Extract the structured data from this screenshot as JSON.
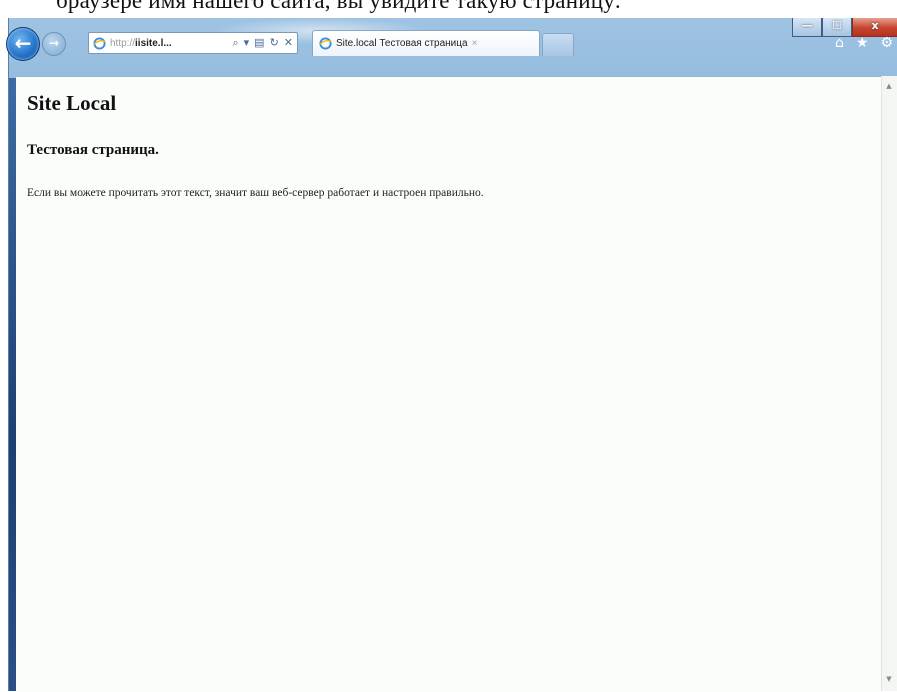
{
  "caption": {
    "text": "браузере имя нашего сайта, вы увидите такую страницу:"
  },
  "window_controls": {
    "minimize": "—",
    "maximize": "☐",
    "close": "x"
  },
  "nav": {
    "back_glyph": "←",
    "forward_glyph": "→"
  },
  "addressbar": {
    "url_prefix": "http://",
    "url_host": "iisite.l...",
    "tools": [
      "⌕",
      "▾",
      "▤",
      "↻",
      "✕"
    ]
  },
  "tabs": [
    {
      "label": "Site.local Тестовая страница",
      "close": "×"
    }
  ],
  "toolbar_right": {
    "home": "⌂",
    "favorites": "★",
    "settings": "⚙"
  },
  "page": {
    "h1": "Site Local",
    "h2": "Тестовая страница.",
    "paragraph": "Если вы можете прочитать этот текст, значит ваш веб-сервер работает и настроен правильно."
  },
  "scrollbar": {
    "up": "▲",
    "down": "▼"
  },
  "colors": {
    "accent": "#1f6fc6",
    "frame": "#6f9ecb",
    "close": "#c7442f",
    "page_bg": "#fbfdfb"
  }
}
